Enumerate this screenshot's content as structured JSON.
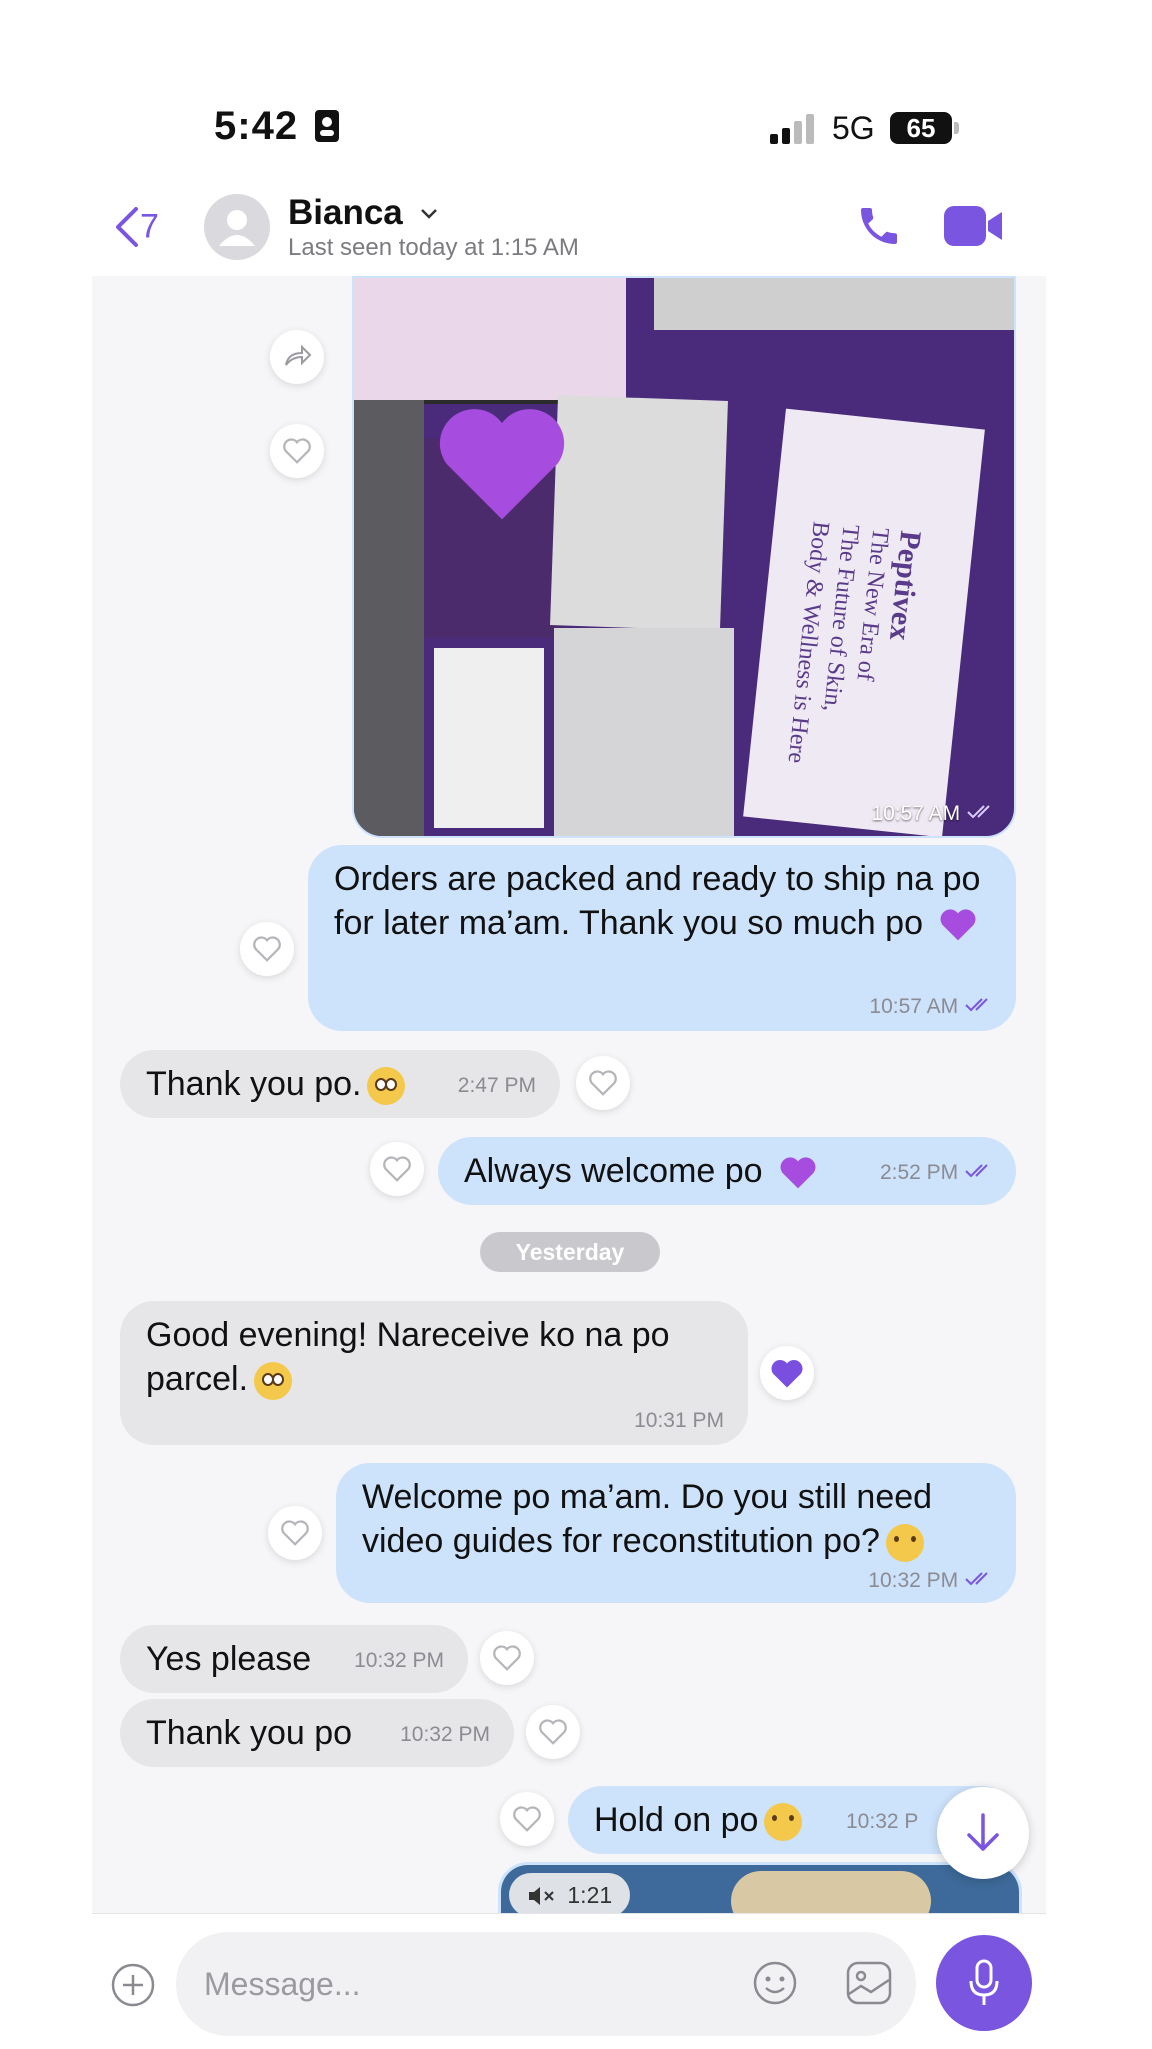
{
  "status": {
    "time": "5:42",
    "network": "5G",
    "battery": "65"
  },
  "header": {
    "back_count": "7",
    "name": "Bianca",
    "last_seen": "Last seen today at 1:15 AM"
  },
  "photo": {
    "time": "10:57 AM",
    "box_text": [
      "Peptivex",
      "The New Era of",
      "The Future of Skin,",
      "Body & Wellness is Here"
    ]
  },
  "messages": [
    {
      "dir": "out",
      "text": "Orders are packed and ready to ship na po for later ma’am. Thank you so much po",
      "time": "10:57 AM"
    },
    {
      "dir": "in",
      "text": "Thank you po.",
      "time": "2:47 PM"
    },
    {
      "dir": "out",
      "text": "Always welcome po",
      "time": "2:52 PM"
    },
    {
      "dir": "in",
      "text": "Good evening! Nareceive ko na po parcel.",
      "time": "10:31 PM"
    },
    {
      "dir": "out",
      "text": "Welcome po ma’am. Do you still need video guides for reconstitution po?",
      "time": "10:32 PM"
    },
    {
      "dir": "in",
      "text": "Yes please",
      "time": "10:32 PM"
    },
    {
      "dir": "in",
      "text": "Thank you po",
      "time": "10:32 PM"
    },
    {
      "dir": "out",
      "text": "Hold on po",
      "time": "10:32 P"
    }
  ],
  "day_separator": "Yesterday",
  "video": {
    "duration": "1:21"
  },
  "composer": {
    "placeholder": "Message..."
  },
  "colors": {
    "accent": "#7a55e0",
    "outgoing": "#cde2fb",
    "incoming": "#e6e6e9",
    "heart": "#a64de0"
  }
}
